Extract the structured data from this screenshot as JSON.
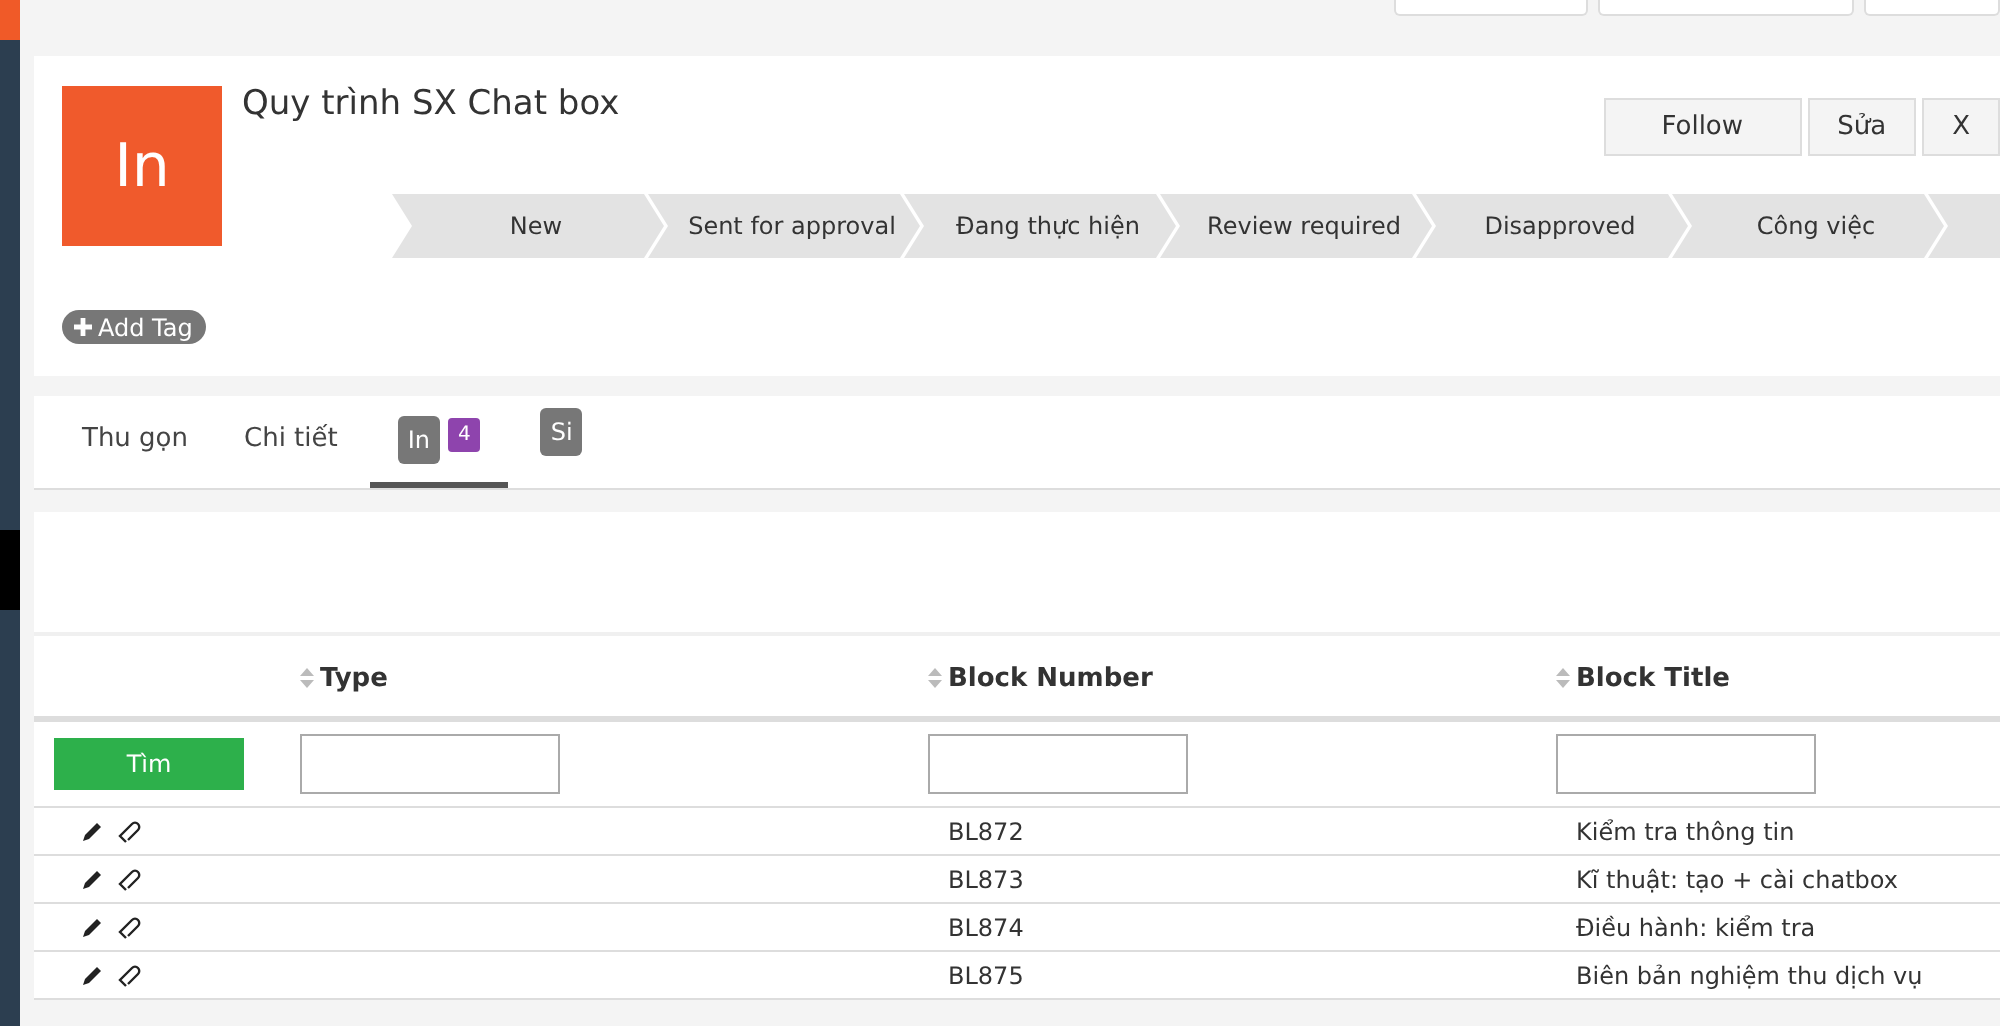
{
  "record": {
    "avatar": "In",
    "title": "Quy trình SX Chat box",
    "add_tag": "Add Tag",
    "buttons": [
      "Follow",
      "Sửa",
      "X"
    ]
  },
  "stages": [
    {
      "label": "New"
    },
    {
      "label": "Sent for approval"
    },
    {
      "label": "Đang thực hiện"
    },
    {
      "label": "Review required"
    },
    {
      "label": "Disapproved"
    },
    {
      "label": "Công việc"
    }
  ],
  "tabs": [
    {
      "label": "Thu gọn",
      "kind": "text",
      "selected": false
    },
    {
      "label": "Chi tiết",
      "kind": "text",
      "selected": false
    },
    {
      "label": "In",
      "kind": "badge",
      "count": "4",
      "selected": true
    },
    {
      "label": "Si",
      "kind": "badge",
      "selected": false
    }
  ],
  "table": {
    "columns": [
      "Type",
      "Block Number",
      "Block Title"
    ],
    "search_button": "Tìm",
    "rows": [
      {
        "block_number": "BL872",
        "block_title": "Kiểm tra thông tin"
      },
      {
        "block_number": "BL873",
        "block_title": "Kĩ thuật: tạo + cài chatbox"
      },
      {
        "block_number": "BL874",
        "block_title": "Điều hành: kiểm tra"
      },
      {
        "block_number": "BL875",
        "block_title": "Biên bản nghiệm thu dịch vụ"
      }
    ]
  }
}
